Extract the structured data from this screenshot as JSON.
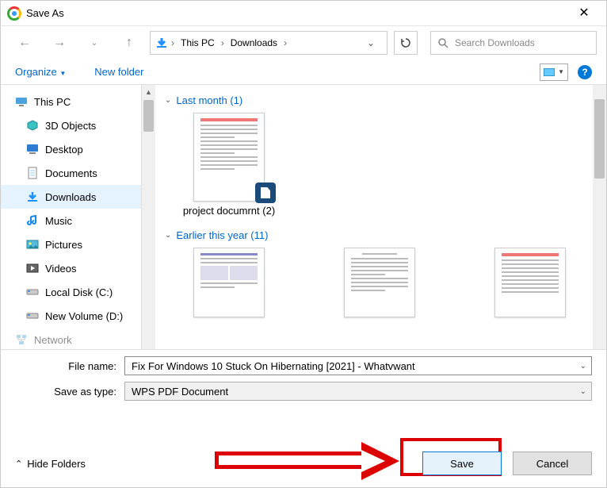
{
  "window": {
    "title": "Save As"
  },
  "nav": {
    "breadcrumb": [
      "This PC",
      "Downloads"
    ],
    "search_placeholder": "Search Downloads"
  },
  "toolbar": {
    "organize": "Organize",
    "newfolder": "New folder"
  },
  "sidebar": {
    "items": [
      {
        "label": "This PC",
        "icon": "pc-icon",
        "root": true
      },
      {
        "label": "3D Objects",
        "icon": "3d-icon"
      },
      {
        "label": "Desktop",
        "icon": "desktop-icon"
      },
      {
        "label": "Documents",
        "icon": "documents-icon"
      },
      {
        "label": "Downloads",
        "icon": "downloads-icon",
        "selected": true
      },
      {
        "label": "Music",
        "icon": "music-icon"
      },
      {
        "label": "Pictures",
        "icon": "pictures-icon"
      },
      {
        "label": "Videos",
        "icon": "videos-icon"
      },
      {
        "label": "Local Disk (C:)",
        "icon": "disk-icon"
      },
      {
        "label": "New Volume (D:)",
        "icon": "disk-icon"
      },
      {
        "label": "Network",
        "icon": "network-icon"
      }
    ]
  },
  "content": {
    "groups": [
      {
        "header": "Last month (1)",
        "files": [
          {
            "name": "project documrnt (2)"
          }
        ]
      },
      {
        "header": "Earlier this year (11)",
        "files": [
          {
            "name": ""
          },
          {
            "name": ""
          },
          {
            "name": ""
          }
        ]
      }
    ]
  },
  "form": {
    "filename_label": "File name:",
    "filename_value": "Fix For Windows 10 Stuck On Hibernating [2021] - Whatvwant",
    "savetype_label": "Save as type:",
    "savetype_value": "WPS PDF Document"
  },
  "footer": {
    "hide_folders": "Hide Folders",
    "save": "Save",
    "cancel": "Cancel"
  }
}
